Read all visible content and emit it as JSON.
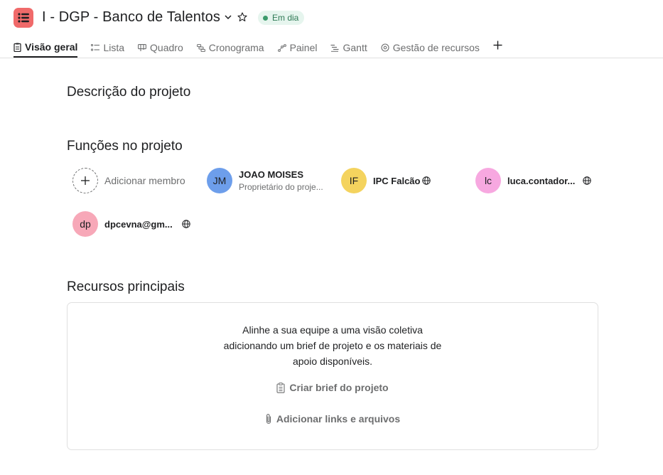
{
  "header": {
    "project_title": "I - DGP - Banco de Talentos",
    "status": "Em dia",
    "project_icon": "list-icon",
    "accent_color": "#f06a6a",
    "status_color": "#3b9a6b"
  },
  "tabs": [
    {
      "label": "Visão geral",
      "icon": "overview-icon",
      "active": true
    },
    {
      "label": "Lista",
      "icon": "list-icon"
    },
    {
      "label": "Quadro",
      "icon": "board-icon"
    },
    {
      "label": "Cronograma",
      "icon": "timeline-icon"
    },
    {
      "label": "Painel",
      "icon": "dashboard-icon"
    },
    {
      "label": "Gantt",
      "icon": "gantt-icon"
    },
    {
      "label": "Gestão de recursos",
      "icon": "resource-icon"
    }
  ],
  "sections": {
    "description_title": "Descrição do projeto",
    "roles_title": "Funções no projeto",
    "resources_title": "Recursos principais"
  },
  "members": {
    "add_label": "Adicionar membro",
    "list": [
      {
        "initials": "JM",
        "name": "JOAO MOISES",
        "role": "Proprietário do proje...",
        "color": "#6d9eeb"
      },
      {
        "initials": "IF",
        "name": "IPC Falcão",
        "color": "#f4d35e"
      },
      {
        "initials": "lc",
        "name": "luca.contador...",
        "color": "#f7a8e0"
      },
      {
        "initials": "dp",
        "name": "dpcevna@gm...",
        "color": "#f7a8b8"
      }
    ]
  },
  "resources": {
    "line1": "Alinhe a sua equipe a uma visão coletiva",
    "line2": "adicionando um brief de projeto e os materiais de",
    "line3": "apoio disponíveis.",
    "brief_link": "Criar brief do projeto",
    "links_link": "Adicionar links e arquivos"
  }
}
